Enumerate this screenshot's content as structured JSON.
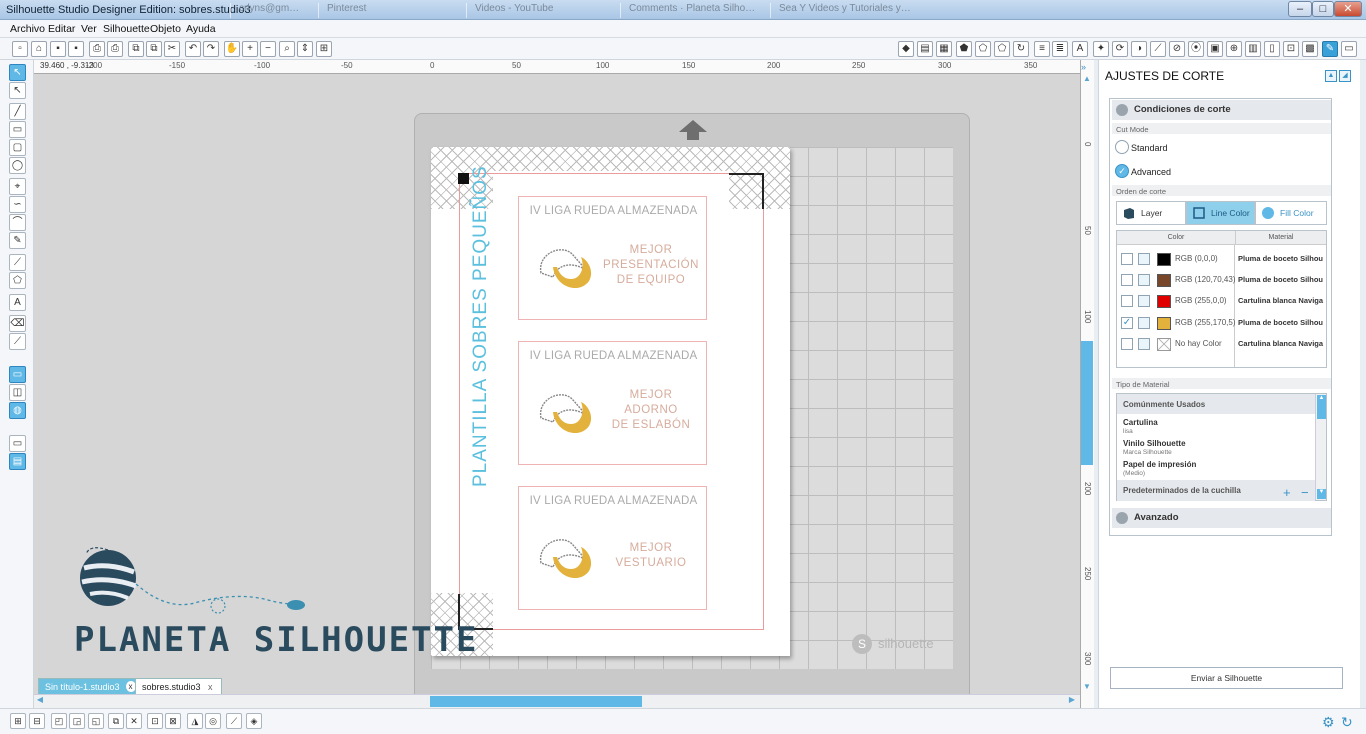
{
  "window": {
    "title": "Silhouette Studio Designer Edition: sobres.studio3",
    "bg_tabs": [
      "crlyns@gm…",
      "Pinterest",
      "Videos - YouTube",
      "Comments · Planeta Silho…",
      "Sea Y Videos y Tutoriales y…"
    ],
    "controls": {
      "minimize": "–",
      "maximize": "□",
      "close": "✕"
    }
  },
  "menu": [
    "Archivo",
    "Editar",
    "Ver",
    "Silhouette",
    "Objeto",
    "Ayuda"
  ],
  "ruler": {
    "coords": "39.460 , -9.313",
    "h_ticks": [
      "-200",
      "-150",
      "-100",
      "-50",
      "0",
      "50",
      "100",
      "150",
      "200",
      "250",
      "300",
      "350"
    ],
    "v_ticks": [
      "0",
      "50",
      "100",
      "150",
      "200",
      "250",
      "300"
    ]
  },
  "design": {
    "vertical_title": "PLANTILLA SOBRES PEQUEÑOS",
    "cards": [
      {
        "header": "IV LIGA RUEDA ALMAZENADA",
        "lines": [
          "MEJOR",
          "PRESENTACIÓN",
          "DE EQUIPO"
        ]
      },
      {
        "header": "IV LIGA RUEDA ALMAZENADA",
        "lines": [
          "MEJOR",
          "ADORNO",
          "DE ESLABÓN"
        ]
      },
      {
        "header": "IV LIGA RUEDA ALMAZENADA",
        "lines": [
          "MEJOR",
          "VESTUARIO"
        ]
      }
    ],
    "mat_brand": "silhouette",
    "watermark": "PLANETA SILHOUETTE"
  },
  "doc_tabs": [
    {
      "label": "Sin título-1.studio3",
      "close": "x",
      "active": false
    },
    {
      "label": "sobres.studio3",
      "close": "x",
      "active": true
    }
  ],
  "panel": {
    "title": "AJUSTES DE CORTE",
    "conditions": "Condiciones de corte",
    "cut_mode_label": "Cut Mode",
    "modes": [
      {
        "label": "Standard",
        "selected": false
      },
      {
        "label": "Advanced",
        "selected": true
      }
    ],
    "order_label": "Orden de corte",
    "order_tabs": [
      {
        "label": "Layer",
        "active": false
      },
      {
        "label": "Line Color",
        "active": true
      },
      {
        "label": "Fill Color",
        "active": false
      }
    ],
    "table_headers": [
      "Color",
      "Material"
    ],
    "rows": [
      {
        "checked": false,
        "color": "#000000",
        "label": "RGB (0,0,0)",
        "material": "Pluma de boceto Silhou"
      },
      {
        "checked": false,
        "color": "#784628",
        "label": "RGB (120,70,43)",
        "material": "Pluma de boceto Silhou"
      },
      {
        "checked": false,
        "color": "#ff0000",
        "label": "RGB (255,0,0)",
        "material": "Cartulina blanca Naviga"
      },
      {
        "checked": true,
        "color": "#ffaa05",
        "label": "RGB (255,170,5)",
        "material": "Pluma de boceto Silhou"
      },
      {
        "checked": false,
        "color": "none",
        "label": "No hay Color",
        "material": "Cartulina blanca Naviga"
      }
    ],
    "material_type_label": "Tipo de Material",
    "material_group": "Comúnmente Usados",
    "materials": [
      {
        "name": "Cartulina",
        "sub": "lisa"
      },
      {
        "name": "Vinilo Silhouette",
        "sub": "Marca Silhouette"
      },
      {
        "name": "Papel de impresión",
        "sub": "(Medio)"
      }
    ],
    "blade_presets": "Predeterminados de la cuchilla",
    "plus": "+",
    "minus": "−",
    "advanced": "Avanzado",
    "send": "Enviar a Silhouette"
  },
  "colors": {
    "accent": "#5bc0de",
    "panel_tab_active": "#8ecfeb",
    "mat": "#c9c9c9"
  }
}
